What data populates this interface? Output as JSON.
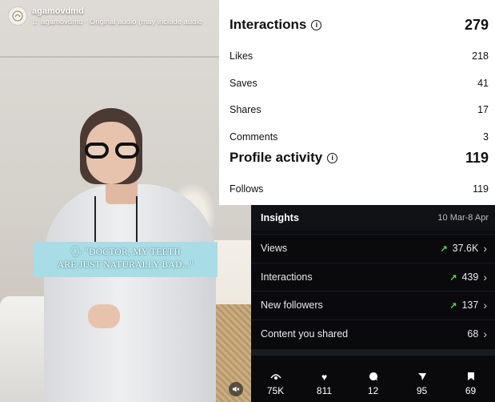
{
  "reel": {
    "account_name": "agamovdmd",
    "audio_icon": "music-note-icon",
    "audio_text": "agamovdmd · Original audio (may include audio",
    "caption_line1": "\"DOCTOR, MY TEETH",
    "caption_line2": "ARE JUST NATURALLY BAD...\"",
    "caption_color": "#a8dde5",
    "mute_icon": "speaker-muted-icon"
  },
  "interactions_panel": {
    "title": "Interactions",
    "total": "279",
    "rows": [
      {
        "label": "Likes",
        "value": "218"
      },
      {
        "label": "Saves",
        "value": "41"
      },
      {
        "label": "Shares",
        "value": "17"
      },
      {
        "label": "Comments",
        "value": "3"
      }
    ],
    "profile_title": "Profile activity",
    "profile_total": "119",
    "profile_rows": [
      {
        "label": "Follows",
        "value": "119"
      }
    ]
  },
  "insights_panel": {
    "title": "Insights",
    "date_range": "10 Mar-8 Apr",
    "rows": [
      {
        "label": "Views",
        "value": "37.6K",
        "trend": "↗"
      },
      {
        "label": "Interactions",
        "value": "439",
        "trend": "↗"
      },
      {
        "label": "New followers",
        "value": "137",
        "trend": "↗"
      },
      {
        "label": "Content you shared",
        "value": "68",
        "trend": ""
      }
    ],
    "trend_color": "#4cd964"
  },
  "stats_bar": [
    {
      "icon": "eye-icon",
      "value": "75K"
    },
    {
      "icon": "heart-icon",
      "value": "811"
    },
    {
      "icon": "comment-icon",
      "value": "12"
    },
    {
      "icon": "send-icon",
      "value": "95"
    },
    {
      "icon": "bookmark-icon",
      "value": "69"
    }
  ]
}
